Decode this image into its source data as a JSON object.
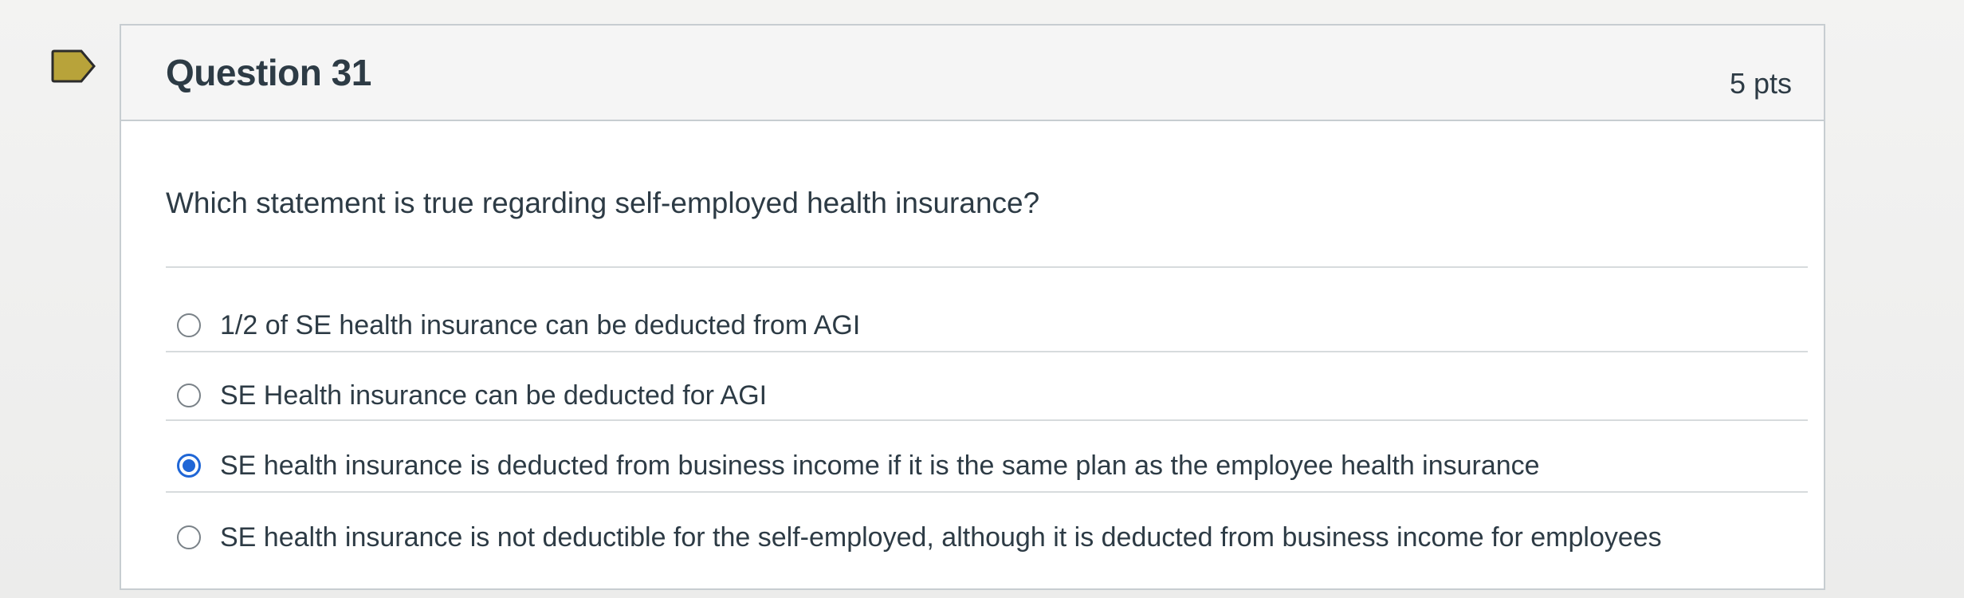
{
  "question": {
    "title": "Question 31",
    "points": "5 pts",
    "text": "Which statement is true regarding self-employed health insurance?",
    "flag_icon": "flag-icon",
    "selected_index": 2,
    "answers": [
      {
        "label": "1/2 of SE health insurance can be deducted from AGI",
        "selected": false
      },
      {
        "label": "SE Health insurance can be deducted for AGI",
        "selected": false
      },
      {
        "label": "SE health insurance is deducted from business income if it is the same plan as the employee health insurance",
        "selected": true
      },
      {
        "label": "SE health insurance is not deductible for the self-employed, although it is deducted from business income for employees",
        "selected": false
      }
    ]
  },
  "colors": {
    "accent": "#1f66d6",
    "flag": "#b8a33a",
    "text": "#2d3b45"
  }
}
